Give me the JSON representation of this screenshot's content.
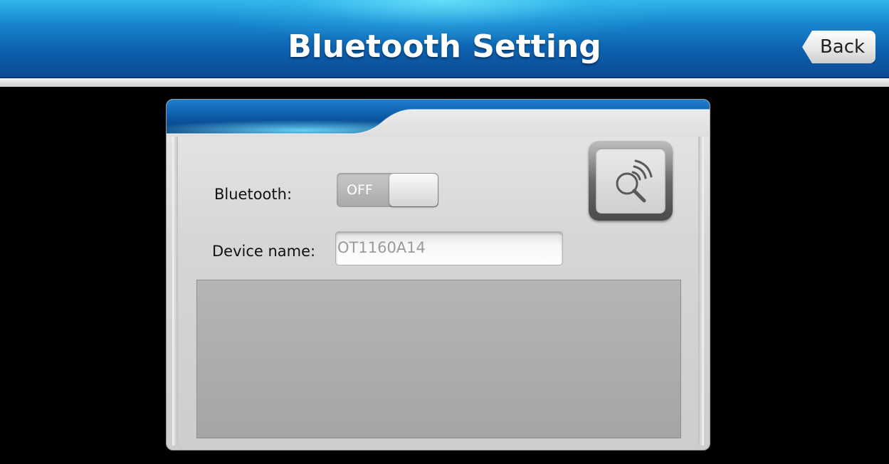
{
  "header": {
    "title": "Bluetooth Setting",
    "back_label": "Back",
    "color_top": "#2fb7ea",
    "color_bottom": "#0a4a92"
  },
  "settings": {
    "bluetooth_label": "Bluetooth:",
    "bluetooth_toggle_state": "OFF",
    "device_name_label": "Device name:",
    "device_name_value": "OT1160A14",
    "scan_icon": "search-bluetooth-icon"
  },
  "device_list": {
    "items": []
  }
}
